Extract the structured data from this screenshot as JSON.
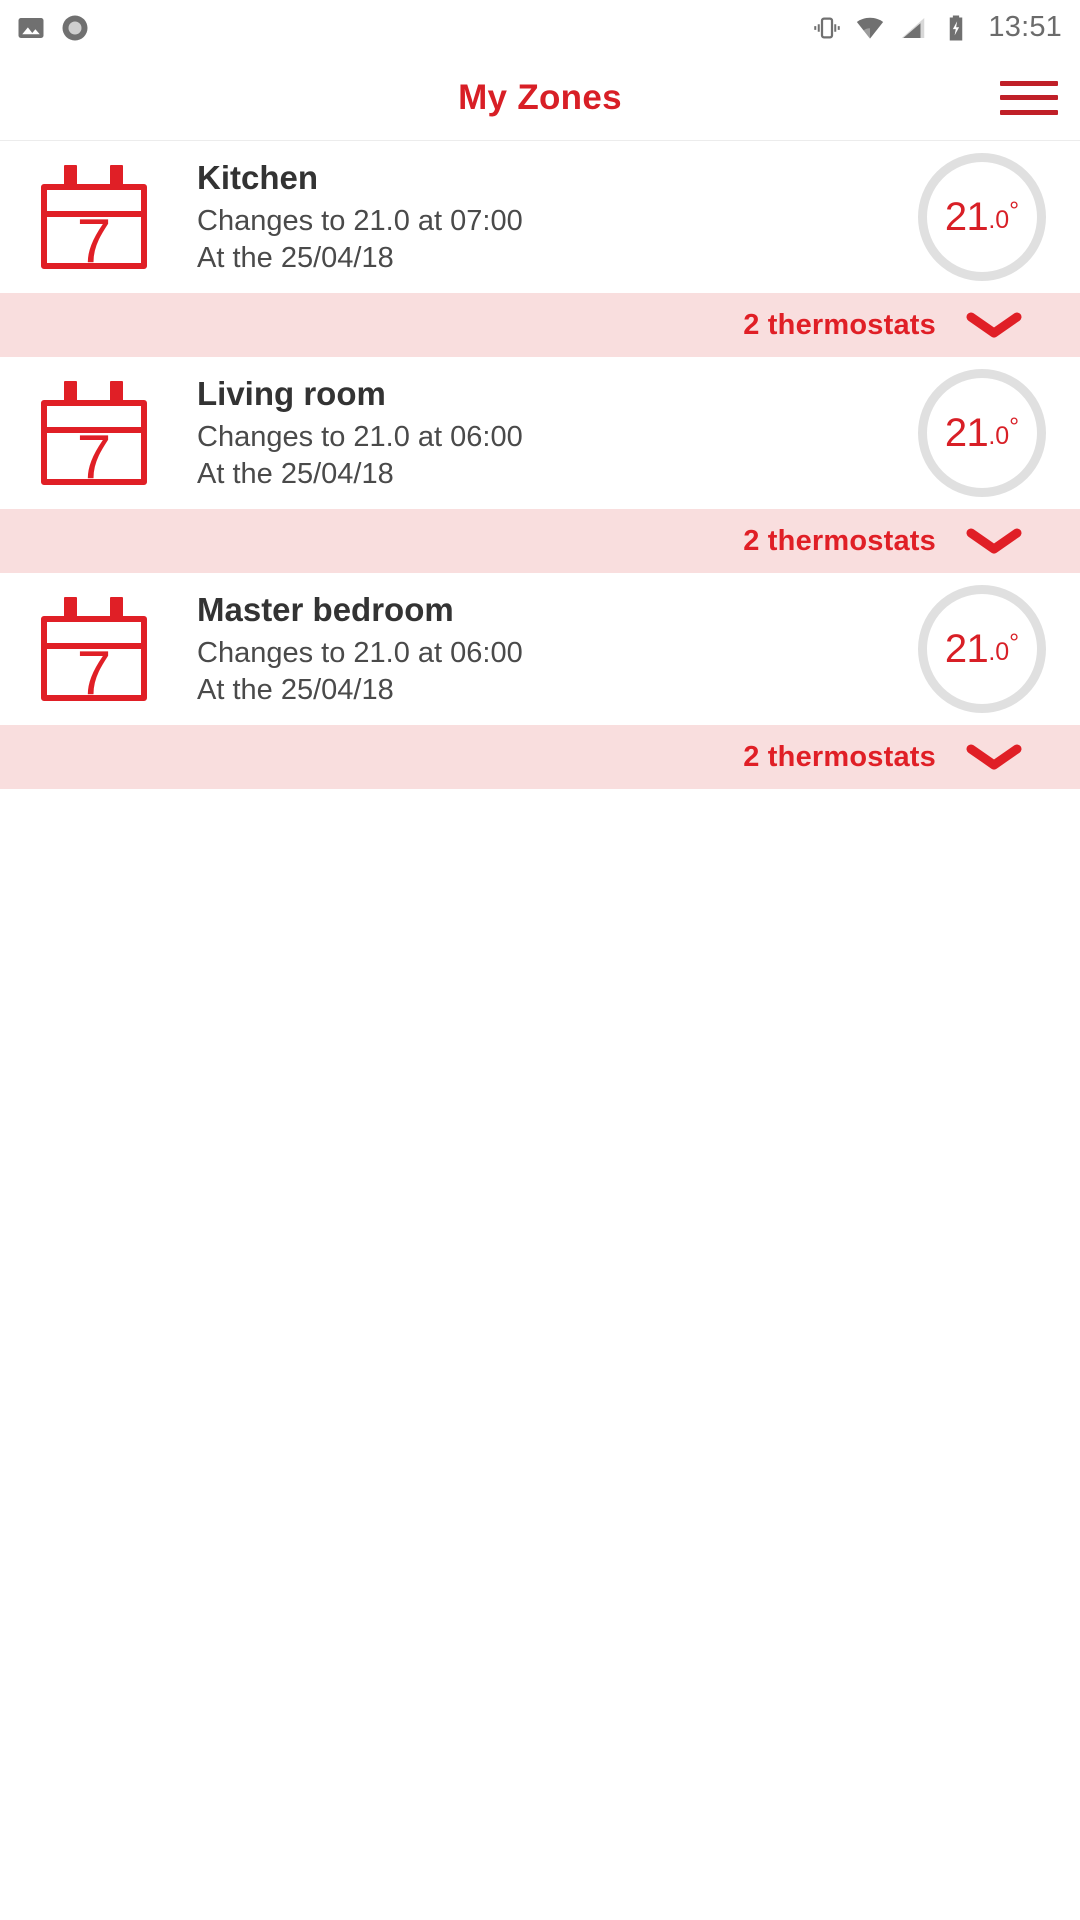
{
  "status_bar": {
    "left_icons": [
      "image-icon",
      "record-circle-icon"
    ],
    "right_icons": [
      "vibrate-icon",
      "wifi-icon",
      "signal-icon",
      "battery-charging-icon"
    ],
    "time": "13:51"
  },
  "header": {
    "title": "My Zones",
    "menu_icon": "hamburger-menu-icon"
  },
  "colors": {
    "brand_red": "#d81f26",
    "icon_red": "#e01f26",
    "bar_pink": "#f9dede",
    "ring_gray": "#e0e0e0",
    "title_dark": "#333333"
  },
  "zones": [
    {
      "calendar_day": "7",
      "name": "Kitchen",
      "schedule_line": "Changes to 21.0 at 07:00",
      "date_line": "At the 25/04/18",
      "temp_int": "21",
      "temp_dec": ".0",
      "temp_unit": "°",
      "thermostats_label": "2 thermostats",
      "expand_icon": "chevron-down-icon"
    },
    {
      "calendar_day": "7",
      "name": "Living room",
      "schedule_line": "Changes to 21.0 at 06:00",
      "date_line": "At the 25/04/18",
      "temp_int": "21",
      "temp_dec": ".0",
      "temp_unit": "°",
      "thermostats_label": "2 thermostats",
      "expand_icon": "chevron-down-icon"
    },
    {
      "calendar_day": "7",
      "name": "Master bedroom",
      "schedule_line": "Changes to 21.0 at 06:00",
      "date_line": "At the 25/04/18",
      "temp_int": "21",
      "temp_dec": ".0",
      "temp_unit": "°",
      "thermostats_label": "2 thermostats",
      "expand_icon": "chevron-down-icon"
    }
  ]
}
